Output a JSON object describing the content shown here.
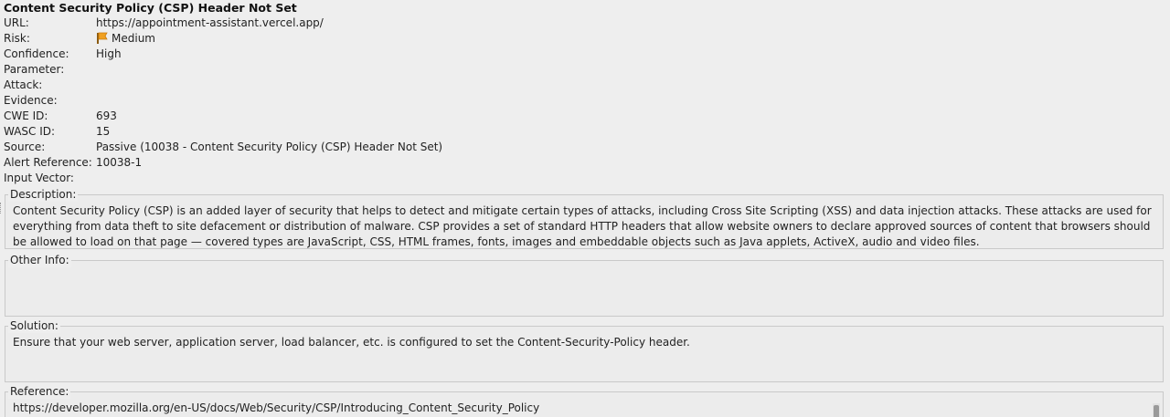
{
  "alert": {
    "title": "Content Security Policy (CSP) Header Not Set",
    "fields": [
      {
        "key": "URL:",
        "value": "https://appointment-assistant.vercel.app/"
      },
      {
        "key": "Risk:",
        "value": "Medium",
        "icon": "orange-flag-icon"
      },
      {
        "key": "Confidence:",
        "value": "High"
      },
      {
        "key": "Parameter:",
        "value": ""
      },
      {
        "key": "Attack:",
        "value": ""
      },
      {
        "key": "Evidence:",
        "value": ""
      },
      {
        "key": "CWE ID:",
        "value": "693"
      },
      {
        "key": "WASC ID:",
        "value": "15"
      },
      {
        "key": "Source:",
        "value": "Passive (10038 - Content Security Policy (CSP) Header Not Set)"
      },
      {
        "key": "Alert Reference:",
        "value": "10038-1"
      },
      {
        "key": "Input Vector:",
        "value": ""
      }
    ]
  },
  "sections": {
    "description": {
      "label": "Description:",
      "text": "Content Security Policy (CSP) is an added layer of security that helps to detect and mitigate certain types of attacks, including Cross Site Scripting (XSS) and data injection attacks. These attacks are used for everything from data theft to site defacement or distribution of malware. CSP provides a set of standard HTTP headers that allow website owners to declare approved sources of content that browsers should be allowed to load on that page — covered types are JavaScript, CSS, HTML frames, fonts, images and embeddable objects such as Java applets, ActiveX, audio and video files."
    },
    "other_info": {
      "label": "Other Info:",
      "text": ""
    },
    "solution": {
      "label": "Solution:",
      "text": "Ensure that your web server, application server, load balancer, etc. is configured to set the Content-Security-Policy header."
    },
    "reference": {
      "label": "Reference:",
      "text": "https://developer.mozilla.org/en-US/docs/Web/Security/CSP/Introducing_Content_Security_Policy"
    }
  },
  "colors": {
    "flag_orange": "#f0a020",
    "background": "#eeeeee",
    "box_border": "#c9c9c9"
  }
}
